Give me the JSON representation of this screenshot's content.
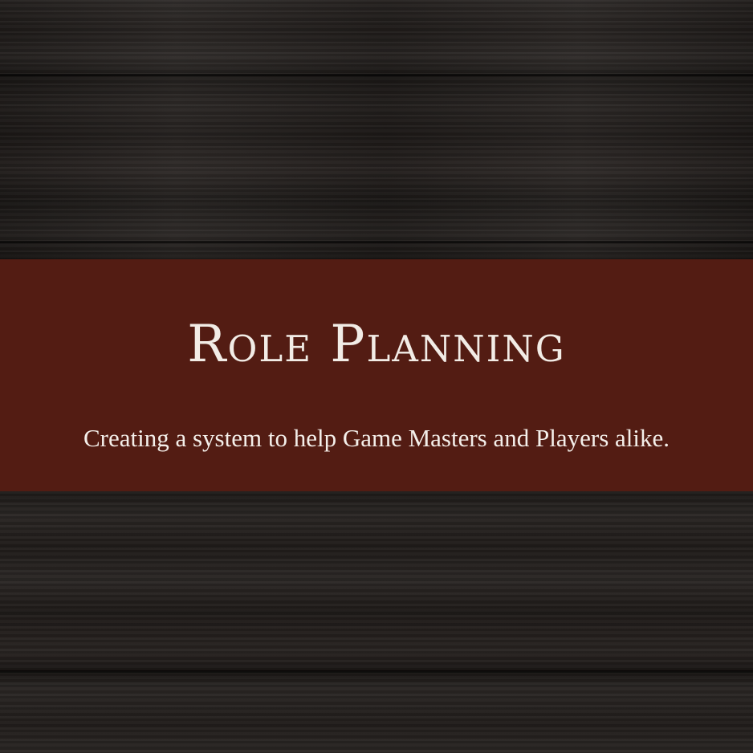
{
  "banner": {
    "title": "Role Planning",
    "subtitle": "Creating a system to help Game Masters and Players alike."
  },
  "colors": {
    "banner_background": "#531c13",
    "text": "#f2ece6",
    "wood_dark": "#1e1a18"
  }
}
